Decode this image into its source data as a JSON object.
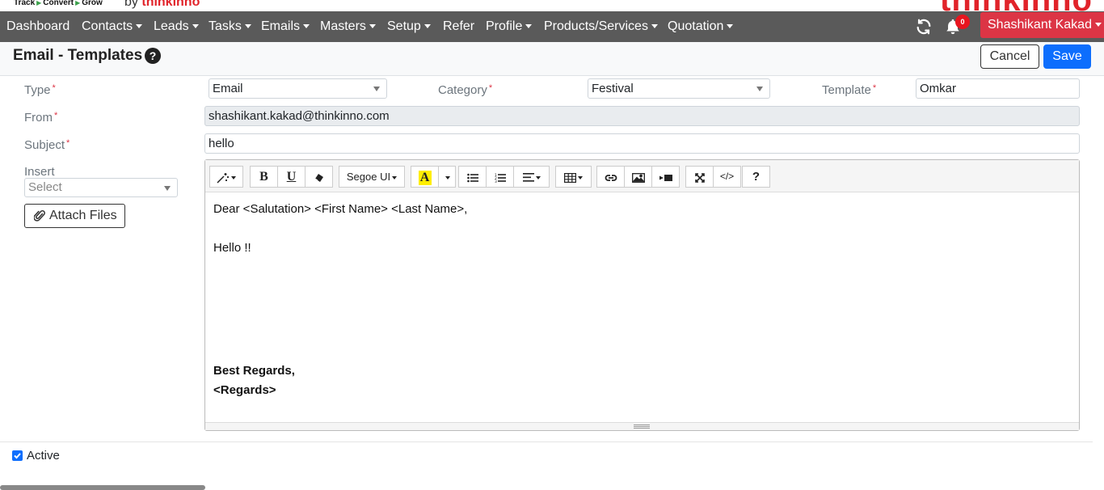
{
  "brand": {
    "tagline": [
      "Track",
      "Convert",
      "Grow"
    ],
    "by": "by",
    "brand_small": "thinkinno",
    "logo": "thinkinno"
  },
  "nav": {
    "items": [
      {
        "label": "Dashboard",
        "dropdown": false
      },
      {
        "label": "Contacts",
        "dropdown": true
      },
      {
        "label": "Leads",
        "dropdown": true
      },
      {
        "label": "Tasks",
        "dropdown": true
      },
      {
        "label": "Emails",
        "dropdown": true
      },
      {
        "label": "Masters",
        "dropdown": true
      },
      {
        "label": "Setup",
        "dropdown": true
      },
      {
        "label": "Refer",
        "dropdown": false
      },
      {
        "label": "Profile",
        "dropdown": true
      },
      {
        "label": "Products/Services",
        "dropdown": true
      },
      {
        "label": "Quotation",
        "dropdown": true
      }
    ],
    "notification_count": "0",
    "user_name": "Shashikant Kakad",
    "bg_color": "#5a5a5a",
    "user_color": "#dc3545"
  },
  "header": {
    "title": "Email - Templates",
    "cancel_label": "Cancel",
    "save_label": "Save"
  },
  "form": {
    "type_label": "Type",
    "type_value": "Email",
    "category_label": "Category",
    "category_value": "Festival",
    "template_label": "Template",
    "template_value": "Omkar",
    "from_label": "From",
    "from_value": "shashikant.kakad@thinkinno.com",
    "subject_label": "Subject",
    "subject_value": "hello",
    "insert_label": "Insert",
    "insert_placeholder": "Select",
    "attach_label": "Attach Files",
    "required_mark": "*"
  },
  "editor": {
    "font_name": "Segoe UI",
    "lines": [
      "Dear <Salutation> <First Name> <Last Name>,",
      "Hello !!",
      "Best Regards,",
      "<Regards>"
    ]
  },
  "footer": {
    "active_label": "Active",
    "active_checked": true
  }
}
